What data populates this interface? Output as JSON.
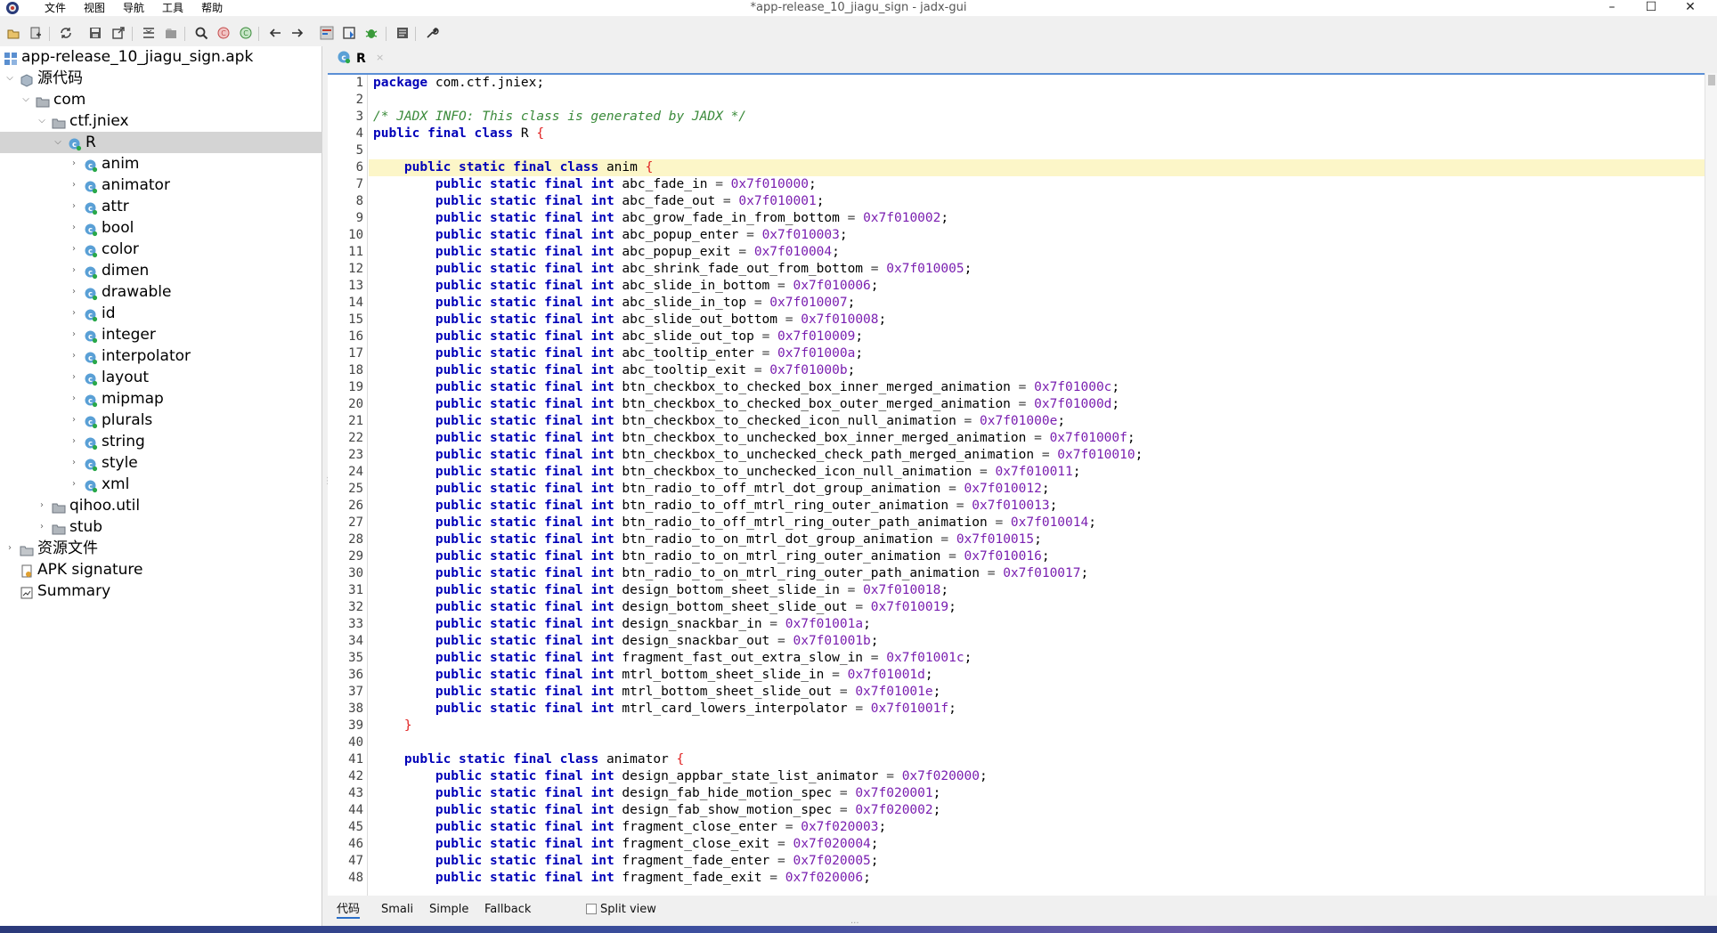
{
  "window": {
    "title": "*app-release_10_jiagu_sign - jadx-gui",
    "menu": [
      "文件",
      "视图",
      "导航",
      "工具",
      "帮助"
    ],
    "controls": [
      "–",
      "☐",
      "✕"
    ]
  },
  "toolbar": {
    "icons": [
      "open-file-icon",
      "add-files-icon",
      "sync-icon",
      "save-all-icon",
      "export-icon",
      "flatten-packages-icon",
      "deobfuscation-icon",
      "search-icon",
      "find-class-icon",
      "find-usage-icon",
      "back-icon",
      "forward-icon",
      "quark-icon",
      "bookmark-icon",
      "debugger-icon",
      "log-viewer-icon",
      "settings-icon"
    ]
  },
  "tree": {
    "items": [
      {
        "label": "app-release_10_jiagu_sign.apk",
        "icon": "apk-icon",
        "level": 0,
        "toggle": ""
      },
      {
        "label": "源代码",
        "icon": "source-code-icon",
        "level": 1,
        "toggle": "v"
      },
      {
        "label": "com",
        "icon": "package-icon",
        "level": 2,
        "toggle": "v"
      },
      {
        "label": "ctf.jniex",
        "icon": "package-icon",
        "level": 3,
        "toggle": "v"
      },
      {
        "label": "R",
        "icon": "class-icon",
        "level": 4,
        "toggle": "v",
        "selected": true
      },
      {
        "label": "anim",
        "icon": "class-icon",
        "level": 5,
        "toggle": ">"
      },
      {
        "label": "animator",
        "icon": "class-icon",
        "level": 5,
        "toggle": ">"
      },
      {
        "label": "attr",
        "icon": "class-icon",
        "level": 5,
        "toggle": ">"
      },
      {
        "label": "bool",
        "icon": "class-icon",
        "level": 5,
        "toggle": ">"
      },
      {
        "label": "color",
        "icon": "class-icon",
        "level": 5,
        "toggle": ">"
      },
      {
        "label": "dimen",
        "icon": "class-icon",
        "level": 5,
        "toggle": ">"
      },
      {
        "label": "drawable",
        "icon": "class-icon",
        "level": 5,
        "toggle": ">"
      },
      {
        "label": "id",
        "icon": "class-icon",
        "level": 5,
        "toggle": ">"
      },
      {
        "label": "integer",
        "icon": "class-icon",
        "level": 5,
        "toggle": ">"
      },
      {
        "label": "interpolator",
        "icon": "class-icon",
        "level": 5,
        "toggle": ">"
      },
      {
        "label": "layout",
        "icon": "class-icon",
        "level": 5,
        "toggle": ">"
      },
      {
        "label": "mipmap",
        "icon": "class-icon",
        "level": 5,
        "toggle": ">"
      },
      {
        "label": "plurals",
        "icon": "class-icon",
        "level": 5,
        "toggle": ">"
      },
      {
        "label": "string",
        "icon": "class-icon",
        "level": 5,
        "toggle": ">"
      },
      {
        "label": "style",
        "icon": "class-icon",
        "level": 5,
        "toggle": ">"
      },
      {
        "label": "xml",
        "icon": "class-icon",
        "level": 5,
        "toggle": ">"
      },
      {
        "label": "qihoo.util",
        "icon": "package-icon",
        "level": 3,
        "toggle": ">"
      },
      {
        "label": "stub",
        "icon": "package-icon",
        "level": 3,
        "toggle": ">"
      },
      {
        "label": "资源文件",
        "icon": "resources-folder-icon",
        "level": 1,
        "toggle": ">"
      },
      {
        "label": "APK signature",
        "icon": "signature-icon",
        "level": 1,
        "toggle": ""
      },
      {
        "label": "Summary",
        "icon": "summary-icon",
        "level": 1,
        "toggle": ""
      }
    ]
  },
  "editor": {
    "tab_label": "R",
    "tab_close": "×",
    "highlighted_line": 6,
    "lines": [
      {
        "kind": "pkg",
        "text": "com.ctf.jniex;"
      },
      {
        "kind": "blank"
      },
      {
        "kind": "comment",
        "text": "/* JADX INFO: This class is generated by JADX */"
      },
      {
        "kind": "classdecl",
        "mods": "public final class",
        "name": "R",
        "indent": ""
      },
      {
        "kind": "blank"
      },
      {
        "kind": "classdecl",
        "mods": "public static final class",
        "name": "anim",
        "indent": "    "
      },
      {
        "kind": "field",
        "name": "abc_fade_in",
        "value": "0x7f010000"
      },
      {
        "kind": "field",
        "name": "abc_fade_out",
        "value": "0x7f010001"
      },
      {
        "kind": "field",
        "name": "abc_grow_fade_in_from_bottom",
        "value": "0x7f010002"
      },
      {
        "kind": "field",
        "name": "abc_popup_enter",
        "value": "0x7f010003"
      },
      {
        "kind": "field",
        "name": "abc_popup_exit",
        "value": "0x7f010004"
      },
      {
        "kind": "field",
        "name": "abc_shrink_fade_out_from_bottom",
        "value": "0x7f010005"
      },
      {
        "kind": "field",
        "name": "abc_slide_in_bottom",
        "value": "0x7f010006"
      },
      {
        "kind": "field",
        "name": "abc_slide_in_top",
        "value": "0x7f010007"
      },
      {
        "kind": "field",
        "name": "abc_slide_out_bottom",
        "value": "0x7f010008"
      },
      {
        "kind": "field",
        "name": "abc_slide_out_top",
        "value": "0x7f010009"
      },
      {
        "kind": "field",
        "name": "abc_tooltip_enter",
        "value": "0x7f01000a"
      },
      {
        "kind": "field",
        "name": "abc_tooltip_exit",
        "value": "0x7f01000b"
      },
      {
        "kind": "field",
        "name": "btn_checkbox_to_checked_box_inner_merged_animation",
        "value": "0x7f01000c"
      },
      {
        "kind": "field",
        "name": "btn_checkbox_to_checked_box_outer_merged_animation",
        "value": "0x7f01000d"
      },
      {
        "kind": "field",
        "name": "btn_checkbox_to_checked_icon_null_animation",
        "value": "0x7f01000e"
      },
      {
        "kind": "field",
        "name": "btn_checkbox_to_unchecked_box_inner_merged_animation",
        "value": "0x7f01000f"
      },
      {
        "kind": "field",
        "name": "btn_checkbox_to_unchecked_check_path_merged_animation",
        "value": "0x7f010010"
      },
      {
        "kind": "field",
        "name": "btn_checkbox_to_unchecked_icon_null_animation",
        "value": "0x7f010011"
      },
      {
        "kind": "field",
        "name": "btn_radio_to_off_mtrl_dot_group_animation",
        "value": "0x7f010012"
      },
      {
        "kind": "field",
        "name": "btn_radio_to_off_mtrl_ring_outer_animation",
        "value": "0x7f010013"
      },
      {
        "kind": "field",
        "name": "btn_radio_to_off_mtrl_ring_outer_path_animation",
        "value": "0x7f010014"
      },
      {
        "kind": "field",
        "name": "btn_radio_to_on_mtrl_dot_group_animation",
        "value": "0x7f010015"
      },
      {
        "kind": "field",
        "name": "btn_radio_to_on_mtrl_ring_outer_animation",
        "value": "0x7f010016"
      },
      {
        "kind": "field",
        "name": "btn_radio_to_on_mtrl_ring_outer_path_animation",
        "value": "0x7f010017"
      },
      {
        "kind": "field",
        "name": "design_bottom_sheet_slide_in",
        "value": "0x7f010018"
      },
      {
        "kind": "field",
        "name": "design_bottom_sheet_slide_out",
        "value": "0x7f010019"
      },
      {
        "kind": "field",
        "name": "design_snackbar_in",
        "value": "0x7f01001a"
      },
      {
        "kind": "field",
        "name": "design_snackbar_out",
        "value": "0x7f01001b"
      },
      {
        "kind": "field",
        "name": "fragment_fast_out_extra_slow_in",
        "value": "0x7f01001c"
      },
      {
        "kind": "field",
        "name": "mtrl_bottom_sheet_slide_in",
        "value": "0x7f01001d"
      },
      {
        "kind": "field",
        "name": "mtrl_bottom_sheet_slide_out",
        "value": "0x7f01001e"
      },
      {
        "kind": "field",
        "name": "mtrl_card_lowers_interpolator",
        "value": "0x7f01001f"
      },
      {
        "kind": "close",
        "indent": "    "
      },
      {
        "kind": "blank"
      },
      {
        "kind": "classdecl",
        "mods": "public static final class",
        "name": "animator",
        "indent": "    "
      },
      {
        "kind": "field",
        "name": "design_appbar_state_list_animator",
        "value": "0x7f020000"
      },
      {
        "kind": "field",
        "name": "design_fab_hide_motion_spec",
        "value": "0x7f020001"
      },
      {
        "kind": "field",
        "name": "design_fab_show_motion_spec",
        "value": "0x7f020002"
      },
      {
        "kind": "field",
        "name": "fragment_close_enter",
        "value": "0x7f020003"
      },
      {
        "kind": "field",
        "name": "fragment_close_exit",
        "value": "0x7f020004"
      },
      {
        "kind": "field",
        "name": "fragment_fade_enter",
        "value": "0x7f020005"
      },
      {
        "kind": "field",
        "name": "fragment_fade_exit",
        "value": "0x7f020006"
      }
    ],
    "keywords": {
      "package": "package",
      "field_mods": "public static final int"
    }
  },
  "bottom_tabs": {
    "tabs": [
      "代码",
      "Smali",
      "Simple",
      "Fallback"
    ],
    "active": "代码",
    "split_view_label": "Split view",
    "split_view_checked": false
  },
  "colors": {
    "keyword": "#0000b8",
    "number": "#7a1fb0",
    "comment": "#3a8a3a",
    "brace": "#e02020",
    "highlight_line": "#fcf6c8",
    "selection": "#d4d4d4"
  }
}
